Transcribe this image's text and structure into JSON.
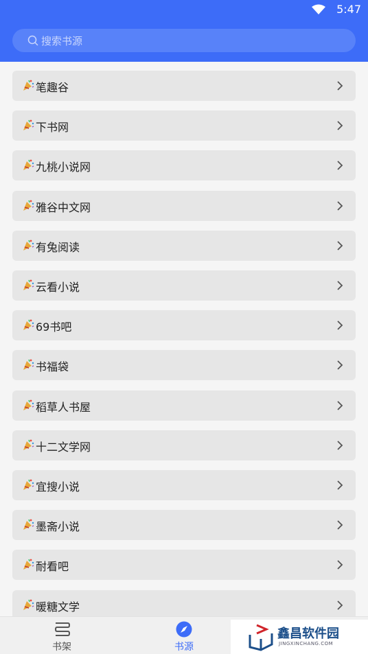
{
  "status": {
    "time": "5:47"
  },
  "search": {
    "placeholder": "搜索书源"
  },
  "sources": [
    "笔趣谷",
    "下书网",
    "九桃小说网",
    "雅谷中文网",
    "有兔阅读",
    "云看小说",
    "69书吧",
    "书福袋",
    "稻草人书屋",
    "十二文学网",
    "宜搜小说",
    "墨斋小说",
    "耐看吧",
    "暖糖文学"
  ],
  "nav": {
    "items": [
      {
        "label": "书架",
        "icon": "bookshelf-icon",
        "active": false
      },
      {
        "label": "书源",
        "icon": "compass-icon",
        "active": true
      }
    ]
  },
  "watermark": {
    "title": "鑫昌软件园",
    "subtitle": "JINGXINCHANG.COM"
  },
  "colors": {
    "header": "#3d6cf8",
    "active": "#3d6cf8",
    "inactive": "#555555",
    "row": "#e6e6e6"
  }
}
